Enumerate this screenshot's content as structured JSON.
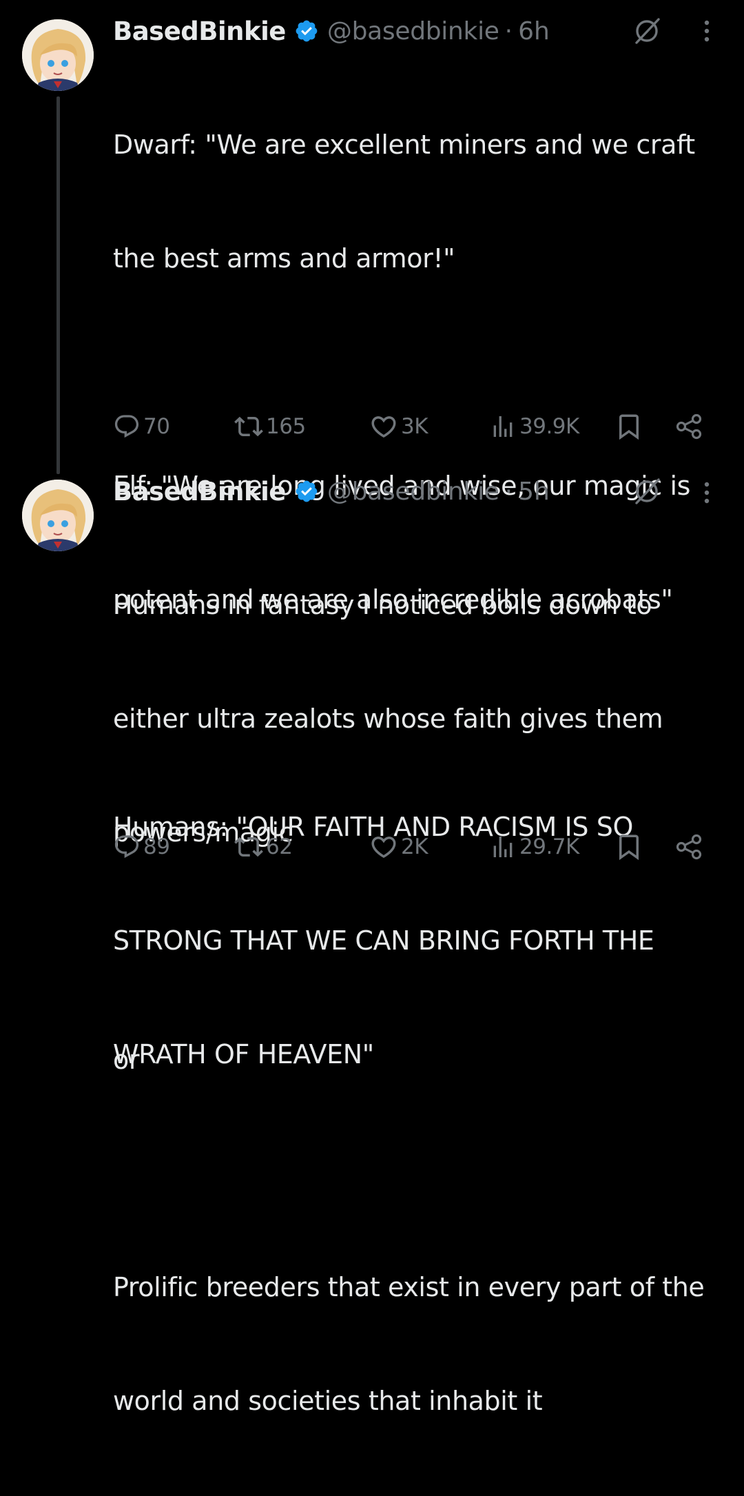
{
  "tweets": [
    {
      "author": {
        "name": "BasedBinkie",
        "handle": "@basedbinkie",
        "verified": true
      },
      "time": "6h",
      "text": "Dwarf: \"We are excellent miners and we craft the best arms and armor!\"\n\nElf: \"We are long lived and wise, our magic is potent and we are also incredible acrobats\"\n\nHumans: \"OUR FAITH AND RACISM IS SO STRONG THAT WE CAN BRING FORTH THE WRATH OF HEAVEN\"",
      "lines": [
        "Dwarf: \"We are excellent miners and we craft",
        "the best arms and armor!\"",
        "",
        "Elf: \"We are long lived and wise, our magic is",
        "potent and we are also incredible acrobats\"",
        "",
        "Humans: \"OUR FAITH AND RACISM IS SO",
        "STRONG THAT WE CAN BRING FORTH THE",
        "WRATH OF HEAVEN\""
      ],
      "replies": "70",
      "reposts": "165",
      "likes": "3K",
      "views": "39.9K"
    },
    {
      "author": {
        "name": "BasedBinkie",
        "handle": "@basedbinkie",
        "verified": true
      },
      "time": "5h",
      "lines": [
        "Humans in fantasy I noticed boils down to",
        "either ultra zealots whose faith gives them",
        "powers/magic",
        "",
        "or",
        "",
        "Prolific breeders that exist in every part of the",
        "world and societies that inhabit it"
      ],
      "replies": "89",
      "reposts": "62",
      "likes": "2K",
      "views": "29.7K"
    }
  ],
  "icons": {
    "verified": "verified-badge-icon",
    "grok": "grok-icon",
    "more": "more-options-icon",
    "reply": "reply-icon",
    "repost": "repost-icon",
    "like": "like-icon",
    "views": "views-icon",
    "bookmark": "bookmark-icon",
    "share": "share-icon"
  },
  "colors": {
    "background": "#000000",
    "text": "#e7e9ea",
    "muted": "#71767b",
    "verified": "#1d9bf0",
    "thread_line": "#333639"
  }
}
